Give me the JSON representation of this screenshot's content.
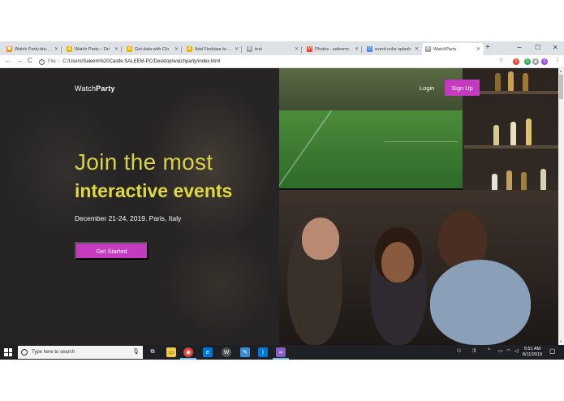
{
  "browser": {
    "tabs": [
      {
        "label": "Watch Party.drawio",
        "favicon_color": "#f08705",
        "favicon_glyph": "▣"
      },
      {
        "label": "Watch Party – Dri",
        "favicon_color": "#f4b400",
        "favicon_glyph": "▲"
      },
      {
        "label": "Get data with Clo",
        "favicon_color": "#f4b400",
        "favicon_glyph": "▲"
      },
      {
        "label": "Add Firebase to yo",
        "favicon_color": "#f4b400",
        "favicon_glyph": "▲"
      },
      {
        "label": "test",
        "favicon_color": "#9aa0a6",
        "favicon_glyph": "◍"
      },
      {
        "label": "Photos - saleemc",
        "favicon_color": "#ea4335",
        "favicon_glyph": "M"
      },
      {
        "label": "event color splash",
        "favicon_color": "#4285f4",
        "favicon_glyph": "G"
      },
      {
        "label": "WatchParty",
        "favicon_color": "#9aa0a6",
        "favicon_glyph": "◍"
      }
    ],
    "new_tab": "+",
    "window_controls": {
      "minimize": "─",
      "maximize": "☐",
      "close": "✕"
    },
    "nav": {
      "back": "←",
      "forward": "→",
      "reload": "C"
    },
    "address": {
      "info": "i",
      "scheme": "File",
      "path": "C:/Users/Saleem%20Castle.SALEEM-PC/Desktop/watchparty/index.html"
    },
    "extensions": [
      {
        "name": "star-icon",
        "glyph": "☆",
        "color": "#5f6368"
      },
      {
        "name": "ext-shield-icon",
        "glyph": "9",
        "color": "#ea4335"
      },
      {
        "name": "ext-g-icon",
        "glyph": "G",
        "color": "#34a853"
      },
      {
        "name": "ext-circle-icon",
        "glyph": "◉",
        "color": "#5f6368"
      },
      {
        "name": "profile-avatar",
        "glyph": "S",
        "color": "#a142f4"
      },
      {
        "name": "menu-icon",
        "glyph": "⋮",
        "color": "#5f6368"
      }
    ]
  },
  "site": {
    "brand_prefix": "Watch",
    "brand_bold": "Party",
    "login": "Login",
    "signup": "Sign Up",
    "headline_light": "Join the most",
    "headline_bold": "interactive events",
    "dateline": "December 21-24, 2019. Paris, Italy",
    "cta": "Get Started",
    "colors": {
      "accent": "#c53bbf",
      "headline": "#d8d24a",
      "background": "#262424"
    }
  },
  "taskbar": {
    "search_placeholder": "Type here to search",
    "apps": [
      {
        "name": "task-view-icon",
        "glyph": "⧉",
        "color": "#1f2024"
      },
      {
        "name": "file-explorer-icon",
        "glyph": "▭",
        "color": "#f2c94c"
      },
      {
        "name": "chrome-icon",
        "glyph": "◉",
        "color": "#db4437"
      },
      {
        "name": "edge-icon",
        "glyph": "e",
        "color": "#0078d7"
      },
      {
        "name": "app-w-icon",
        "glyph": "W",
        "color": "#555555"
      },
      {
        "name": "app-sticky-icon",
        "glyph": "✎",
        "color": "#3a8ed8"
      },
      {
        "name": "vscode-icon",
        "glyph": "⟩",
        "color": "#0078d4"
      },
      {
        "name": "visual-studio-icon",
        "glyph": "∞",
        "color": "#865fc5"
      }
    ],
    "tray": {
      "people": "⚇",
      "chevron": "^",
      "battery": "▭",
      "wifi": "◠",
      "volume": "◁",
      "notifications": "▢"
    },
    "time": "5:51 AM",
    "date": "8/11/2019"
  }
}
